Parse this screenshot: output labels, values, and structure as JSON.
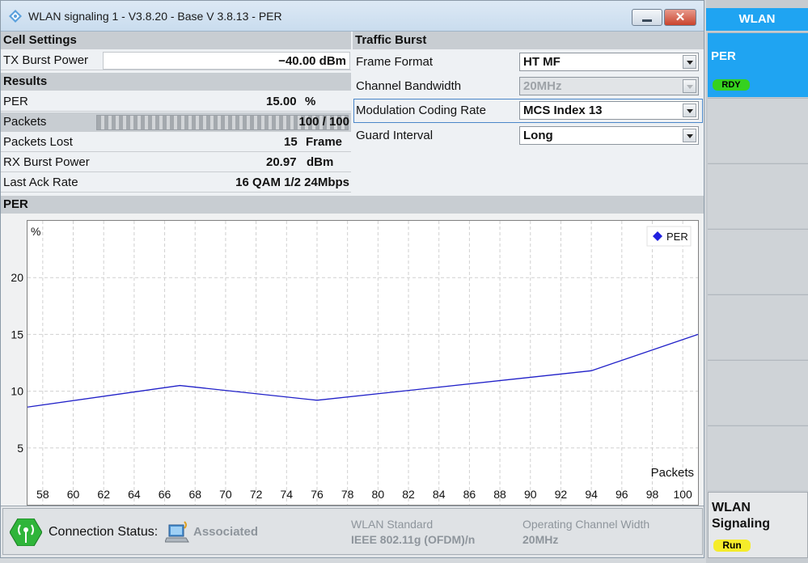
{
  "window": {
    "title": "WLAN signaling 1 - V3.8.20 - Base V 3.8.13 - PER",
    "close_label": "✕"
  },
  "cell_settings": {
    "header": "Cell Settings",
    "tx_burst_power_label": "TX Burst  Power",
    "tx_burst_power_value": "−40.00 dBm"
  },
  "results": {
    "header": "Results",
    "per_label": "PER",
    "per_value": "15.00",
    "per_unit": "%",
    "packets_label": "Packets",
    "packets_value": "100 / 100",
    "packets_progress": 1.0,
    "packets_lost_label": "Packets Lost",
    "packets_lost_value": "15",
    "packets_lost_unit": "Frame",
    "rx_burst_power_label": "RX Burst Power",
    "rx_burst_power_value": "20.97",
    "rx_burst_power_unit": "dBm",
    "last_ack_rate_label": "Last Ack Rate",
    "last_ack_rate_value": "16 QAM 1/2 24Mbps"
  },
  "traffic_burst": {
    "header": "Traffic Burst",
    "rows": [
      {
        "label": "Frame Format",
        "value": "HT MF",
        "disabled": false
      },
      {
        "label": "Channel Bandwidth",
        "value": "20MHz",
        "disabled": true
      },
      {
        "label": "Modulation Coding Rate",
        "value": "MCS Index 13",
        "disabled": false
      },
      {
        "label": "Guard Interval",
        "value": "Long",
        "disabled": false
      }
    ]
  },
  "per_section": {
    "header": "PER"
  },
  "chart_data": {
    "type": "line",
    "title": "",
    "ylabel": "%",
    "xlabel": "Packets",
    "xlim": [
      57,
      101
    ],
    "ylim": [
      0,
      25
    ],
    "xticks": [
      58,
      60,
      62,
      64,
      66,
      68,
      70,
      72,
      74,
      76,
      78,
      80,
      82,
      84,
      86,
      88,
      90,
      92,
      94,
      96,
      98,
      100
    ],
    "yticks": [
      5,
      10,
      15,
      20
    ],
    "grid": true,
    "legend_position": "top-right",
    "series": [
      {
        "name": "PER",
        "color": "#2020c8",
        "x": [
          57,
          67,
          76,
          94,
          101
        ],
        "y": [
          8.6,
          10.5,
          9.2,
          11.8,
          15.0
        ]
      }
    ]
  },
  "status": {
    "connection_label": "Connection Status:",
    "connection_value": "Associated",
    "wlan_standard_label": "WLAN Standard",
    "wlan_standard_value": "IEEE 802.11g (OFDM)/n",
    "channel_width_label": "Operating Channel Width",
    "channel_width_value": "20MHz"
  },
  "side_panel": {
    "header": "WLAN",
    "active_button": "PER",
    "active_badge": "RDY",
    "bottom_line1": "WLAN",
    "bottom_line2": "Signaling",
    "bottom_badge": "Run"
  },
  "colors": {
    "accent": "#1fa4f2",
    "badge_rdy": "#35d11f",
    "badge_run": "#f5ec2a",
    "series_line": "#2020c8"
  }
}
